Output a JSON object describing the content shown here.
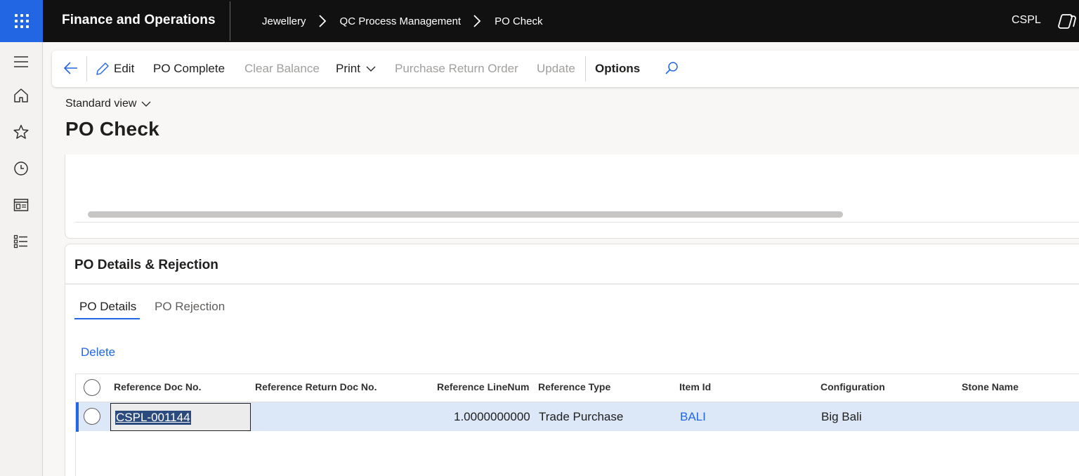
{
  "topbar": {
    "app_title": "Finance and Operations",
    "breadcrumbs": [
      "Jewellery",
      "QC Process Management",
      "PO Check"
    ],
    "company": "CSPL"
  },
  "actions": {
    "edit": "Edit",
    "po_complete": "PO Complete",
    "clear_balance": "Clear Balance",
    "print": "Print",
    "purchase_return_order": "Purchase Return Order",
    "update": "Update",
    "options": "Options"
  },
  "page": {
    "view": "Standard view",
    "title": "PO Check"
  },
  "section": {
    "title": "PO Details & Rejection",
    "tabs": [
      "PO Details",
      "PO Rejection"
    ],
    "delete_label": "Delete"
  },
  "table": {
    "columns": [
      "Reference Doc No.",
      "Reference Return Doc No.",
      "Reference LineNum",
      "Reference Type",
      "Item Id",
      "Configuration",
      "Stone Name"
    ],
    "rows": [
      {
        "ref_doc": "CSPL-001144",
        "ref_return_doc": "",
        "ref_linenum": "1.0000000000",
        "ref_type": "Trade Purchase",
        "item_id": "BALI",
        "configuration": "Big Bali",
        "stone_name": ""
      }
    ]
  },
  "colors": {
    "accent": "#2266e3",
    "topbar": "#111111",
    "selected_row": "#dce7f8"
  }
}
